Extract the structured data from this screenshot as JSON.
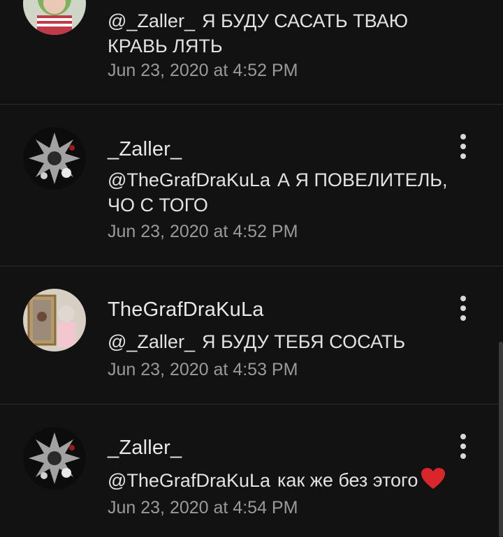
{
  "comments": [
    {
      "author": "",
      "mention": "@_Zaller_",
      "text": "Я БУДУ САСАТЬ ТВАЮ КРАВЬ ЛЯТЬ",
      "time": "Jun 23, 2020 at 4:52 PM",
      "avatar": "girl-avatar",
      "has_menu": false
    },
    {
      "author": "_Zaller_",
      "mention": "@TheGrafDraKuLa",
      "text": "А Я ПОВЕЛИТЕЛЬ, ЧО С ТОГО",
      "time": "Jun 23, 2020 at 4:52 PM",
      "avatar": "dark-flowers-avatar",
      "has_menu": true
    },
    {
      "author": "TheGrafDraKuLa",
      "mention": "@_Zaller_",
      "text": "Я БУДУ ТЕБЯ СОСАТЬ",
      "time": "Jun 23, 2020 at 4:53 PM",
      "avatar": "mirror-selfie-avatar",
      "has_menu": true
    },
    {
      "author": "_Zaller_",
      "mention": "@TheGrafDraKuLa",
      "text": "как же без этого",
      "time": "Jun 23, 2020 at 4:54 PM",
      "avatar": "dark-flowers-avatar",
      "has_menu": true,
      "emoji": "heart-emoji"
    }
  ],
  "colors": {
    "background": "#121212",
    "divider": "#2e2e2e",
    "timestamp": "#9a9a9a",
    "heart": "#d9262b"
  },
  "icons": {
    "menu": "more-vertical-icon"
  }
}
